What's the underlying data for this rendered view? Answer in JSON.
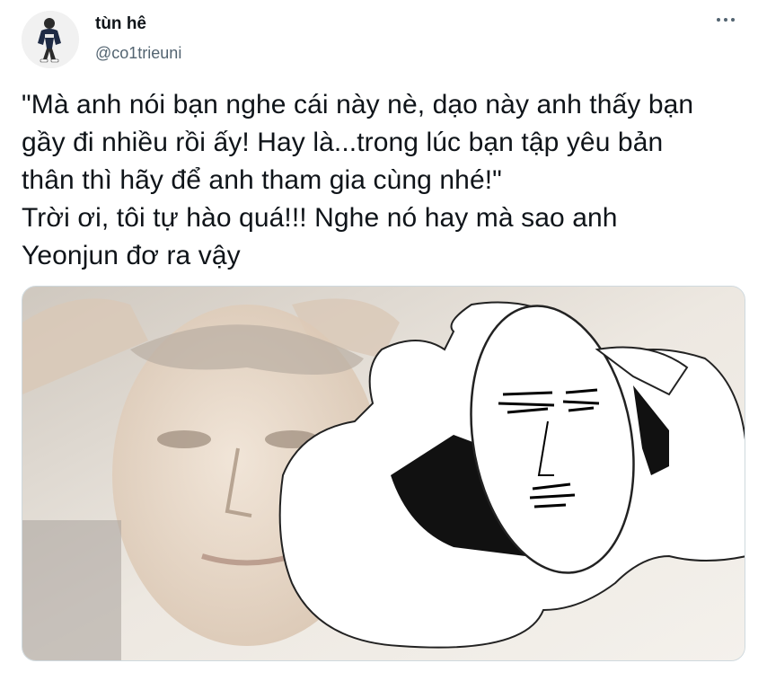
{
  "author": {
    "display_name": "tùn hê",
    "handle": "@co1trieuni",
    "avatar_icon": "user-avatar-icon"
  },
  "actions": {
    "more_icon": "more-options-icon"
  },
  "tweet": {
    "text_lines": [
      "\"Mà anh nói bạn nghe cái này nè, dạo này anh thấy bạn",
      "gầy đi nhiều rồi ấy! Hay là...trong lúc bạn tập yêu bản",
      "thân thì hãy để anh tham gia cùng nhé!\"",
      "Trời ơi, tôi tự hào quá!!! Nghe nó hay mà sao anh",
      "Yeonjun đơ ra vậy"
    ]
  },
  "media": {
    "type": "image",
    "icon": "meme-image"
  },
  "colors": {
    "text_primary": "#0f1419",
    "text_secondary": "#536471",
    "border": "#cfd9de"
  }
}
